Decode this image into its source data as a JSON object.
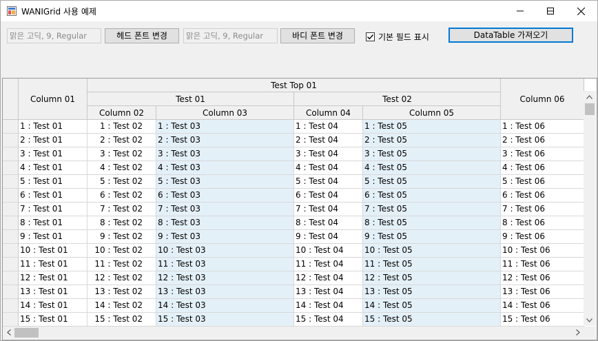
{
  "window": {
    "title": "WANIGrid 사용 예제"
  },
  "toolbar": {
    "head_font_value": "맑은 고딕, 9, Regular",
    "head_font_button": "헤드 폰트 변경",
    "body_font_value": "맑은 고딕, 9, Regular",
    "body_font_button": "바디 폰트 변경",
    "show_default_fields_label": "기본 필드 표시",
    "show_default_fields_checked": true,
    "datatable_button": "DataTable 가져오기"
  },
  "grid": {
    "top_header": "Test Top 01",
    "group_headers": [
      "Test 01",
      "Test 02"
    ],
    "columns": [
      "Column 01",
      "Column 02",
      "Column 03",
      "Column 04",
      "Column 05",
      "Column 06"
    ],
    "rows": [
      [
        "1 : Test 01",
        "1 : Test 02",
        "1 : Test 03",
        "1 : Test 04",
        "1 : Test 05",
        "1 : Test 06"
      ],
      [
        "2 : Test 01",
        "2 : Test 02",
        "2 : Test 03",
        "2 : Test 04",
        "2 : Test 05",
        "2 : Test 06"
      ],
      [
        "3 : Test 01",
        "3 : Test 02",
        "3 : Test 03",
        "3 : Test 04",
        "3 : Test 05",
        "3 : Test 06"
      ],
      [
        "4 : Test 01",
        "4 : Test 02",
        "4 : Test 03",
        "4 : Test 04",
        "4 : Test 05",
        "4 : Test 06"
      ],
      [
        "5 : Test 01",
        "5 : Test 02",
        "5 : Test 03",
        "5 : Test 04",
        "5 : Test 05",
        "5 : Test 06"
      ],
      [
        "6 : Test 01",
        "6 : Test 02",
        "6 : Test 03",
        "6 : Test 04",
        "6 : Test 05",
        "6 : Test 06"
      ],
      [
        "7 : Test 01",
        "7 : Test 02",
        "7 : Test 03",
        "7 : Test 04",
        "7 : Test 05",
        "7 : Test 06"
      ],
      [
        "8 : Test 01",
        "8 : Test 02",
        "8 : Test 03",
        "8 : Test 04",
        "8 : Test 05",
        "8 : Test 06"
      ],
      [
        "9 : Test 01",
        "9 : Test 02",
        "9 : Test 03",
        "9 : Test 04",
        "9 : Test 05",
        "9 : Test 06"
      ],
      [
        "10 : Test 01",
        "10 : Test 02",
        "10 : Test 03",
        "10 : Test 04",
        "10 : Test 05",
        "10 : Test 06"
      ],
      [
        "11 : Test 01",
        "11 : Test 02",
        "11 : Test 03",
        "11 : Test 04",
        "11 : Test 05",
        "11 : Test 06"
      ],
      [
        "12 : Test 01",
        "12 : Test 02",
        "12 : Test 03",
        "12 : Test 04",
        "12 : Test 05",
        "12 : Test 06"
      ],
      [
        "13 : Test 01",
        "13 : Test 02",
        "13 : Test 03",
        "13 : Test 04",
        "13 : Test 05",
        "13 : Test 06"
      ],
      [
        "14 : Test 01",
        "14 : Test 02",
        "14 : Test 03",
        "14 : Test 04",
        "14 : Test 05",
        "14 : Test 06"
      ],
      [
        "15 : Test 01",
        "15 : Test 02",
        "15 : Test 03",
        "15 : Test 04",
        "15 : Test 05",
        "15 : Test 06"
      ]
    ]
  },
  "icons": {
    "app": "app-icon",
    "minimize": "minimize-icon",
    "maximize": "maximize-icon",
    "close": "close-icon",
    "check": "checkmark-icon"
  },
  "colors": {
    "highlight_column_bg": "#e4f0f8",
    "header_bg": "#f0f0f0",
    "accent": "#0078d7"
  }
}
